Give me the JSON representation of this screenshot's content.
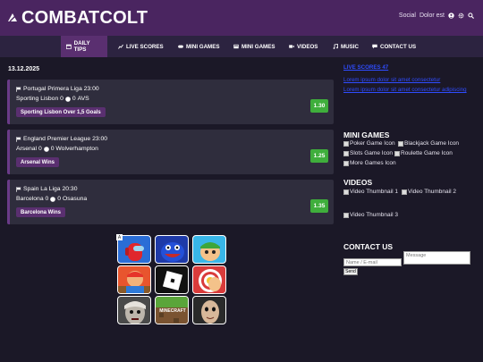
{
  "header": {
    "logo": "COMBATCOLT",
    "links": [
      "Social",
      "Dolor est"
    ],
    "icons": [
      "user-icon",
      "gear-icon",
      "search-icon"
    ]
  },
  "nav": {
    "items": [
      {
        "label": "DAILY TIPS",
        "icon": "calendar-icon",
        "active": true
      },
      {
        "label": "LIVE SCORES",
        "icon": "chart-icon",
        "active": false
      },
      {
        "label": "MINI GAMES",
        "icon": "gamepad-icon",
        "active": false
      },
      {
        "label": "MINI GAMES",
        "icon": "grid-icon",
        "active": false
      },
      {
        "label": "VIDEOS",
        "icon": "video-icon",
        "active": false
      },
      {
        "label": "MUSIC",
        "icon": "music-icon",
        "active": false
      },
      {
        "label": "CONTACT US",
        "icon": "chat-icon",
        "active": false
      }
    ]
  },
  "date": "13.12.2025",
  "matches": [
    {
      "league": "Portugal Primera Liga 23:00",
      "home": "Sporting Lisbon",
      "home_score": "0",
      "away_score": "0",
      "away": "AVS",
      "tip": "Sporting Lisbon Over 1,5 Goals",
      "odds": "1.30"
    },
    {
      "league": "England Premier League 23:00",
      "home": "Arsenal",
      "home_score": "0",
      "away_score": "0",
      "away": "Wolverhampton",
      "tip": "Arsenal Wins",
      "odds": "1.25"
    },
    {
      "league": "Spain La Liga 20:30",
      "home": "Barcelona",
      "home_score": "0",
      "away_score": "0",
      "away": "Osasuna",
      "tip": "Barcelona Wins",
      "odds": "1.35"
    }
  ],
  "games_grid": {
    "ad_mark": "A",
    "tiles": [
      {
        "name": "among-us",
        "bg": "#2a6dd6"
      },
      {
        "name": "huggy",
        "bg": "#1e3aa8"
      },
      {
        "name": "stumble",
        "bg": "#38b6e8"
      },
      {
        "name": "subway",
        "bg": "#e8552e"
      },
      {
        "name": "roblox",
        "bg": "#111111"
      },
      {
        "name": "archery",
        "bg": "#d93b3b"
      },
      {
        "name": "granny",
        "bg": "#4a4a4a"
      },
      {
        "name": "minecraft",
        "bg": "#5b3f24"
      },
      {
        "name": "creepy",
        "bg": "#2a2a2a"
      }
    ],
    "minecraft_label": "MINECRAFT"
  },
  "sidebar": {
    "links": [
      "LIVE SCORES 47",
      "Lorem ipsum dolor sit amet consectetur",
      "Lorem ipsum dolor sit amet consectetur adipiscing"
    ],
    "mini_games_title": "MINI GAMES",
    "mini_games": [
      "Poker Game Icon",
      "Blackjack Game Icon",
      "Slots Game Icon",
      "Roulette Game Icon",
      "More Games Icon"
    ],
    "videos_title": "VIDEOS",
    "videos": [
      "Video Thumbnail 1",
      "Video Thumbnail 2",
      "Video Thumbnail 3"
    ],
    "contact_title": "CONTACT US",
    "contact": {
      "name_placeholder": "Name / E-mail",
      "message_placeholder": "Message",
      "send_label": "Send"
    }
  },
  "colors": {
    "header_bg": "#4a2560",
    "nav_bg": "#2c2340",
    "active_tab": "#5a2f70",
    "page_bg": "#1b1827",
    "card_bg": "#2f2d3d",
    "odds_green": "#3fae3c",
    "link_blue": "#2f4cff"
  }
}
